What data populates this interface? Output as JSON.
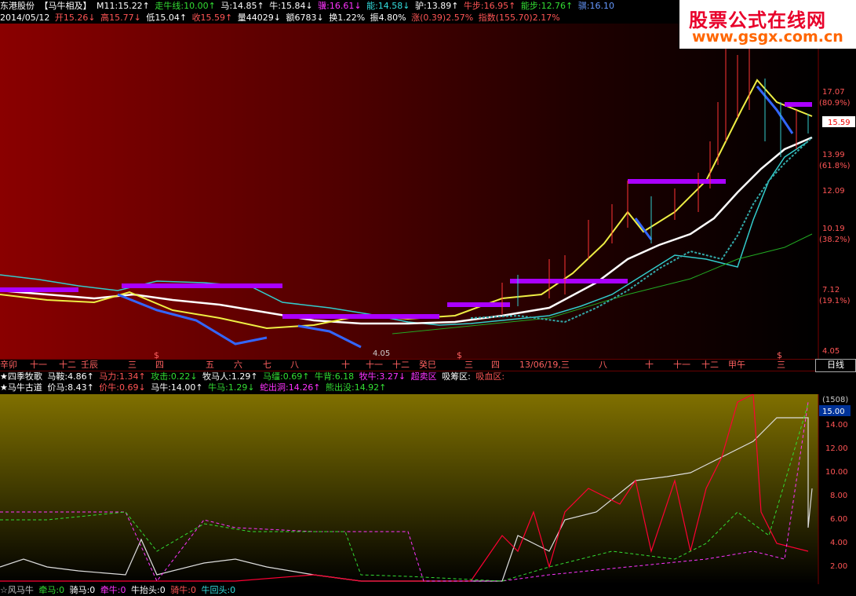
{
  "header": {
    "stock_name": "东港股份",
    "indicator": "【马牛相及】",
    "m11": "M11:15.22↑",
    "niu_line": "走牛线:10.00↑",
    "ma": "马:14.85↑",
    "niu": "牛:15.84↓",
    "ji": "骥:16.61↓",
    "neng": "能:14.58↓",
    "lu": "驴:13.89↑",
    "niu_bu": "牛步:16.95↑",
    "neng_bu": "能步:12.76↑",
    "ji2": "骐:16.10",
    "date": "2014/05/12",
    "open": "开15.26↓",
    "high": "高15.77↓",
    "low": "低15.04↑",
    "close": "收15.59↑",
    "volume": "量44029↓",
    "amount": "额6783↓",
    "turnover": "换1.22%",
    "amplitude": "振4.80%",
    "change": "涨(0.39)2.57%",
    "index_change": "指数(155.70)2.17%"
  },
  "watermark": {
    "title": "股票公式在线网",
    "url": "www.gsgx.com.cn"
  },
  "main_chart": {
    "price_labels": [
      "17.07",
      "(80.9%)",
      "15.59",
      "13.99",
      "(61.8%)",
      "12.09",
      "10.19",
      "(38.2%)",
      "7.12",
      "(19.1%)",
      "4.05"
    ],
    "current_price": "15.59",
    "low_marker": "4.05"
  },
  "date_axis": {
    "labels": [
      "辛卯",
      "十一",
      "十二",
      "壬辰",
      "三",
      "四",
      "五",
      "六",
      "七",
      "八",
      "十",
      "十一",
      "十二",
      "癸巳",
      "三",
      "四",
      "13/06/19,三",
      "八",
      "十",
      "十一",
      "十二",
      "甲午",
      "三"
    ],
    "s_marks": [
      "$",
      "$",
      "$"
    ],
    "day_button": "日线"
  },
  "indicator1": {
    "title": "★四季牧歌",
    "items": [
      "马鞍:4.86↑",
      "马力:1.34↑",
      "攻击:0.22↓",
      "牧马人:1.29↑",
      "马缰:0.69↑",
      "牛背:6.18",
      "牧牛:3.27↓",
      "超卖区",
      "吸筹区:",
      "吸血区:"
    ]
  },
  "indicator2": {
    "title": "★马牛古道",
    "items": [
      "价马:8.43↑",
      "价牛:0.69↓",
      "马牛:14.00↑",
      "牛马:1.29↓",
      "蛇出洞:14.26↑",
      "熊出没:14.92↑"
    ]
  },
  "sub_chart": {
    "labels": [
      "(1508)",
      "15.00",
      "14.00",
      "12.00",
      "10.00",
      "8.00",
      "6.00",
      "4.00",
      "2.00"
    ]
  },
  "footer": {
    "title": "☆风马牛",
    "items": [
      "牵马:0",
      "骑马:0",
      "牵牛:0",
      "牛抬头:0",
      "骑牛:0",
      "牛回头:0"
    ]
  }
}
